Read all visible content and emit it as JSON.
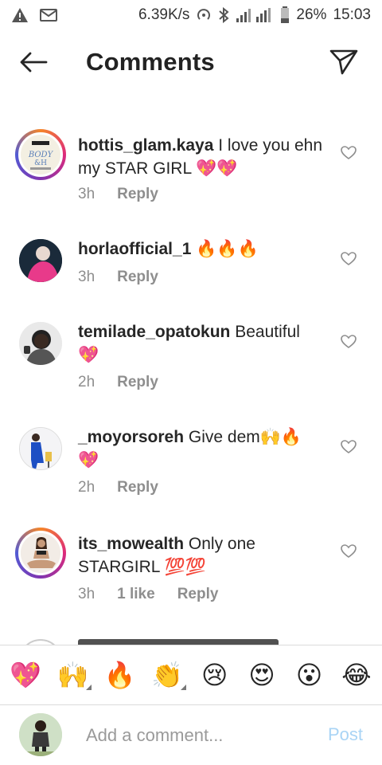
{
  "status_bar": {
    "speed": "6.39K/s",
    "battery": "26%",
    "time": "15:03"
  },
  "header": {
    "title": "Comments"
  },
  "comments": [
    {
      "username": "hottis_glam.kaya",
      "text": "I love you ehn my STAR GIRL 💖💖",
      "time": "3h",
      "reply_label": "Reply"
    },
    {
      "username": "horlaofficial_1",
      "text": "🔥🔥🔥",
      "time": "3h",
      "reply_label": "Reply"
    },
    {
      "username": "temilade_opatokun",
      "text": "Beautiful 💖",
      "time": "2h",
      "reply_label": "Reply"
    },
    {
      "username": "_moyorsoreh",
      "text": "Give dem🙌🔥 💖",
      "time": "2h",
      "reply_label": "Reply"
    },
    {
      "username": "its_mowealth",
      "text": "Only one STARGIRL 💯💯",
      "time": "3h",
      "likes": "1 like",
      "reply_label": "Reply"
    }
  ],
  "emoji_bar": [
    "💖",
    "🙌",
    "🔥",
    "👏",
    "😢",
    "😍",
    "😮",
    "😂"
  ],
  "composer": {
    "placeholder": "Add a comment...",
    "post_label": "Post"
  },
  "colors": {
    "accent_post": "#a9d4f5",
    "heart_pink": "#e3468b",
    "meta_gray": "#8e8e8e"
  }
}
